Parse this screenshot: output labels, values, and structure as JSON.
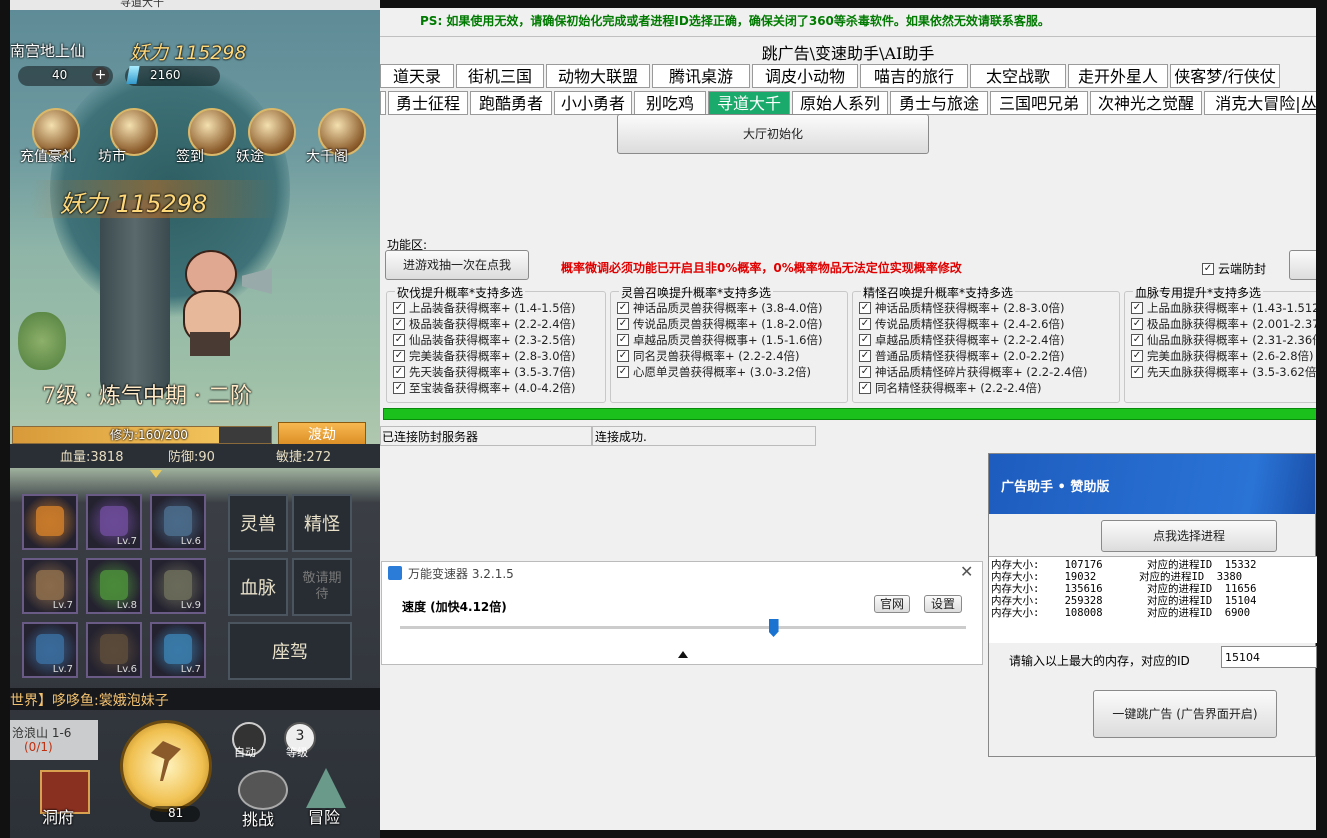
{
  "game": {
    "top_label": "寻道大千",
    "player_name": "南宫地上仙",
    "power_top": "妖力 115298",
    "currency1": "40",
    "currency2": "2160",
    "menu_icons": [
      {
        "label": "充值豪礼",
        "icon": "gift-icon"
      },
      {
        "label": "坊市",
        "icon": "coin-icon"
      },
      {
        "label": "签到",
        "icon": "calendar-icon"
      },
      {
        "label": "妖途",
        "icon": "book-icon"
      },
      {
        "label": "大千阁",
        "icon": "scroll-icon"
      }
    ],
    "power_banner": "妖力 115298",
    "level_text": "7级 · 炼气中期 · 二阶",
    "cultivation": "修为:160/200",
    "cultivation_progress": 0.8,
    "breakthrough_button": "渡劫",
    "stats": {
      "hp": "血量:3818",
      "def": "防御:90",
      "agi": "敏捷:272"
    },
    "equip_slots": [
      {
        "lv": "",
        "icon": "sword-icon"
      },
      {
        "lv": "Lv.7",
        "icon": "armor-icon"
      },
      {
        "lv": "Lv.6",
        "icon": "boots-icon"
      },
      {
        "lv": "Lv.7",
        "icon": "bracer-icon"
      },
      {
        "lv": "Lv.8",
        "icon": "orb-icon"
      },
      {
        "lv": "Lv.9",
        "icon": "necklace-icon"
      },
      {
        "lv": "Lv.7",
        "icon": "beast-icon"
      },
      {
        "lv": "Lv.6",
        "icon": "shield-icon"
      },
      {
        "lv": "Lv.7",
        "icon": "gem-icon"
      }
    ],
    "right_buttons": [
      "灵兽",
      "精怪",
      "血脉",
      "敬请期待",
      "座驾"
    ],
    "chat_text": "世界】哆哆鱼:裳娥泡妹子",
    "stage_name": "沧浪山 1-6",
    "stage_progress": "(0/1)",
    "auto_label": "自动",
    "speed_level": "3",
    "speed_label": "等级",
    "axe_count": "81",
    "bottom_nav": [
      "洞府",
      "挑战",
      "冒险"
    ]
  },
  "tool": {
    "notice": "PS: 如果使用无效，请确保初始化完成或者进程ID选择正确，确保关闭了360等杀毒软件。如果依然无效请联系客服。",
    "title": "跳广告\\变速助手\\AI助手",
    "tabs_row1": [
      "道天录",
      "街机三国",
      "动物大联盟",
      "腾讯桌游",
      "调皮小动物",
      "喵吉的旅行",
      "太空战歌",
      "走开外星人",
      "侠客梦/行侠仗"
    ],
    "tabs_row2": [
      "勇士征程",
      "跑酷勇者",
      "小小勇者",
      "别吃鸡",
      "寻道大千",
      "原始人系列",
      "勇士与旅途",
      "三国吧兄弟",
      "次神光之觉醒",
      "消克大冒险|丛林"
    ],
    "selected_tab": "寻道大千",
    "init_button": "大厅初始化",
    "func_area_label": "功能区:",
    "draw_button": "进游戏抽一次在点我",
    "warning": "概率微调必须功能已开启且非0%概率，0%概率物品无法定位实现概率修改",
    "cloud_checkbox": "云端防封",
    "groups": [
      {
        "title": "砍伐提升概率*支持多选",
        "items": [
          "上品装备获得概率+ (1.4-1.5倍)",
          "极品装备获得概率+ (2.2-2.4倍)",
          "仙品装备获得概率+ (2.3-2.5倍)",
          "完美装备获得概率+ (2.8-3.0倍)",
          "先天装备获得概率+ (3.5-3.7倍)",
          "至宝装备获得概率+ (4.0-4.2倍)"
        ]
      },
      {
        "title": "灵兽召唤提升概率*支持多选",
        "items": [
          "神话品质灵兽获得概率+ (3.8-4.0倍)",
          "传说品质灵兽获得概率+ (1.8-2.0倍)",
          "卓越品质灵兽获得概事+ (1.5-1.6倍)",
          "同名灵兽获得概率+ (2.2-2.4倍)",
          "心愿单灵兽获得概率+ (3.0-3.2倍)"
        ]
      },
      {
        "title": "精怪召唤提升概率*支持多选",
        "items": [
          "神话品质精怪获得概率+ (2.8-3.0倍)",
          "传说品质精怪获得概率+ (2.4-2.6倍)",
          "卓越品质精怪获得概率+ (2.2-2.4倍)",
          "普通品质精怪获得概率+ (2.0-2.2倍)",
          "神话品质精怪碎片获得概率+ (2.2-2.4倍)",
          "同名精怪获得概率+ (2.2-2.4倍)"
        ]
      },
      {
        "title": "血脉专用提升*支持多选",
        "items": [
          "上品血脉获得概率+ (1.43-1.512",
          "极品血脉获得概率+ (2.001-2.37",
          "仙品血脉获得概率+ (2.31-2.36倍",
          "完美血脉获得概率+ (2.6-2.8倍)",
          "先天血脉获得概率+ (3.5-3.62倍"
        ]
      }
    ],
    "status_left": "已连接防封服务器",
    "status_right": "连接成功."
  },
  "speed_window": {
    "title": "万能变速器 3.2.1.5",
    "speed_label": "速度 (加快4.12倍)",
    "official_button": "官网",
    "settings_button": "设置",
    "slider_fraction": 0.66
  },
  "ad_helper": {
    "title": "广告助手 • 赞助版",
    "select_button": "点我选择进程",
    "processes": [
      {
        "mem": "内存大小:    107176",
        "pid": "对应的进程ID  15332"
      },
      {
        "mem": "内存大小:    19032",
        "pid": "对应的进程ID  3380"
      },
      {
        "mem": "内存大小:    135616",
        "pid": "对应的进程ID  11656"
      },
      {
        "mem": "内存大小:    259328",
        "pid": "对应的进程ID  15104"
      },
      {
        "mem": "内存大小:    108008",
        "pid": "对应的进程ID  6900"
      }
    ],
    "input_label": "请输入以上最大的内存，对应的ID",
    "input_value": "15104",
    "skip_button": "一键跳广告 (广告界面开启)"
  },
  "colors": {
    "tab_selected": "#1aaa6b",
    "warning": "#e00000",
    "notice": "#007a00",
    "progress": "#1cc01c",
    "ad_header": "#1f66c8"
  }
}
